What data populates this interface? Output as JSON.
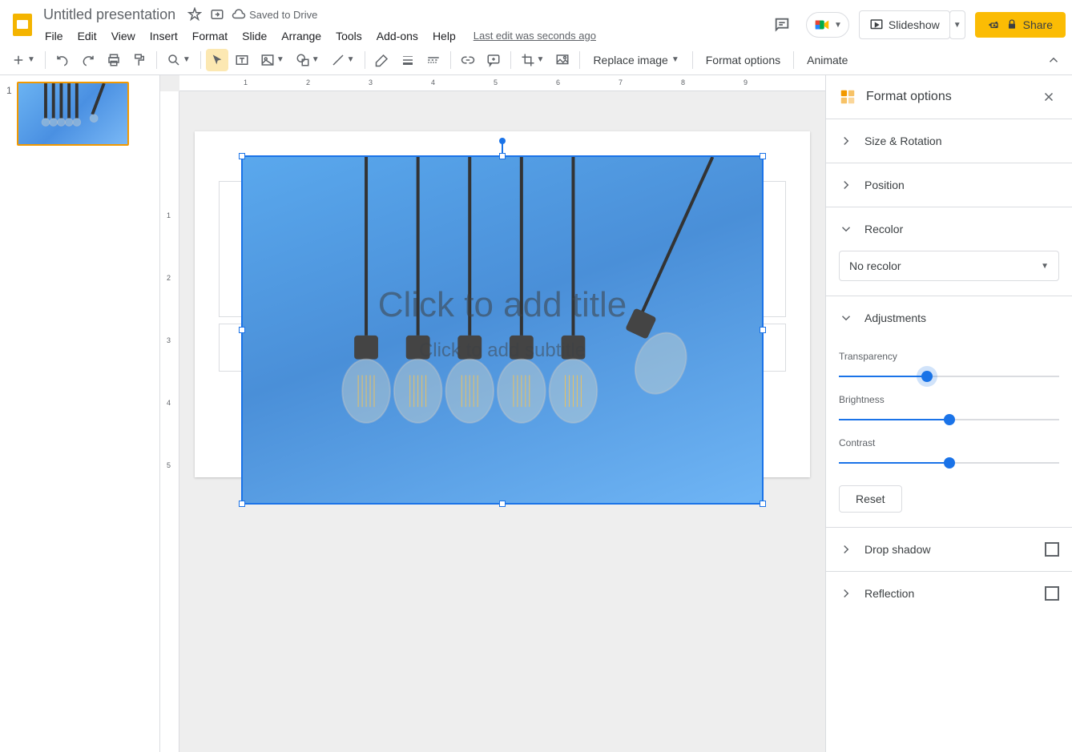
{
  "doc": {
    "title": "Untitled presentation",
    "save_status": "Saved to Drive",
    "last_edit": "Last edit was seconds ago"
  },
  "menus": [
    "File",
    "Edit",
    "View",
    "Insert",
    "Format",
    "Slide",
    "Arrange",
    "Tools",
    "Add-ons",
    "Help"
  ],
  "header_actions": {
    "slideshow": "Slideshow",
    "share": "Share"
  },
  "toolbar": {
    "replace_image": "Replace image",
    "format_options": "Format options",
    "animate": "Animate"
  },
  "filmstrip": {
    "slides": [
      {
        "number": "1"
      }
    ]
  },
  "canvas": {
    "title_placeholder": "Click to add title",
    "subtitle_placeholder": "Click to add subtitle"
  },
  "sidebar": {
    "title": "Format options",
    "sections": {
      "size_rotation": "Size & Rotation",
      "position": "Position",
      "recolor": "Recolor",
      "recolor_value": "No recolor",
      "adjustments": "Adjustments",
      "transparency": "Transparency",
      "brightness": "Brightness",
      "contrast": "Contrast",
      "reset": "Reset",
      "drop_shadow": "Drop shadow",
      "reflection": "Reflection"
    },
    "sliders": {
      "transparency_pct": 40,
      "brightness_pct": 50,
      "contrast_pct": 50
    }
  }
}
